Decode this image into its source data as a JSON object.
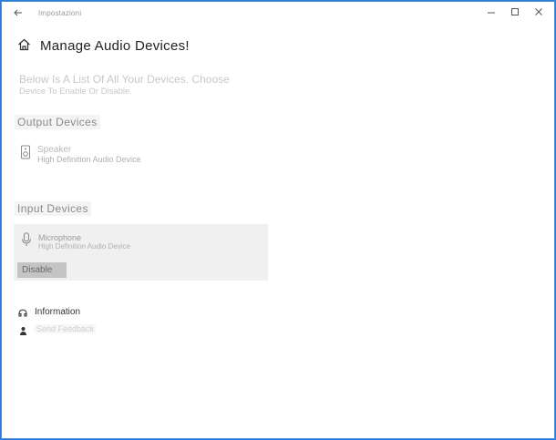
{
  "window": {
    "app_title": "Impostazioni"
  },
  "page": {
    "title": "Manage Audio Devices!",
    "description_line1": "Below Is A List Of All Your Devices. Choose",
    "description_line2": "Device To Enable Or Disable."
  },
  "output_section": {
    "heading": "Output Devices",
    "device": {
      "name": "Speaker",
      "subtitle": "High Definition Audio Device"
    }
  },
  "input_section": {
    "heading": "Input Devices",
    "device": {
      "name": "Microphone",
      "subtitle": "High Definition Audio Device",
      "button_label": "Disable"
    }
  },
  "links": {
    "information": "Information",
    "feedback": "Send Feedback"
  },
  "icons": {
    "back": "back-arrow-icon",
    "home": "home-icon",
    "minimize": "minimize-icon",
    "maximize": "maximize-icon",
    "close": "close-icon",
    "speaker": "speaker-icon",
    "microphone": "microphone-icon",
    "information": "info-icon",
    "feedback": "feedback-icon"
  },
  "colors": {
    "accent": "#2b7bd6",
    "card_bg": "#f0f0f0",
    "button_bg": "#c4c4c4"
  }
}
